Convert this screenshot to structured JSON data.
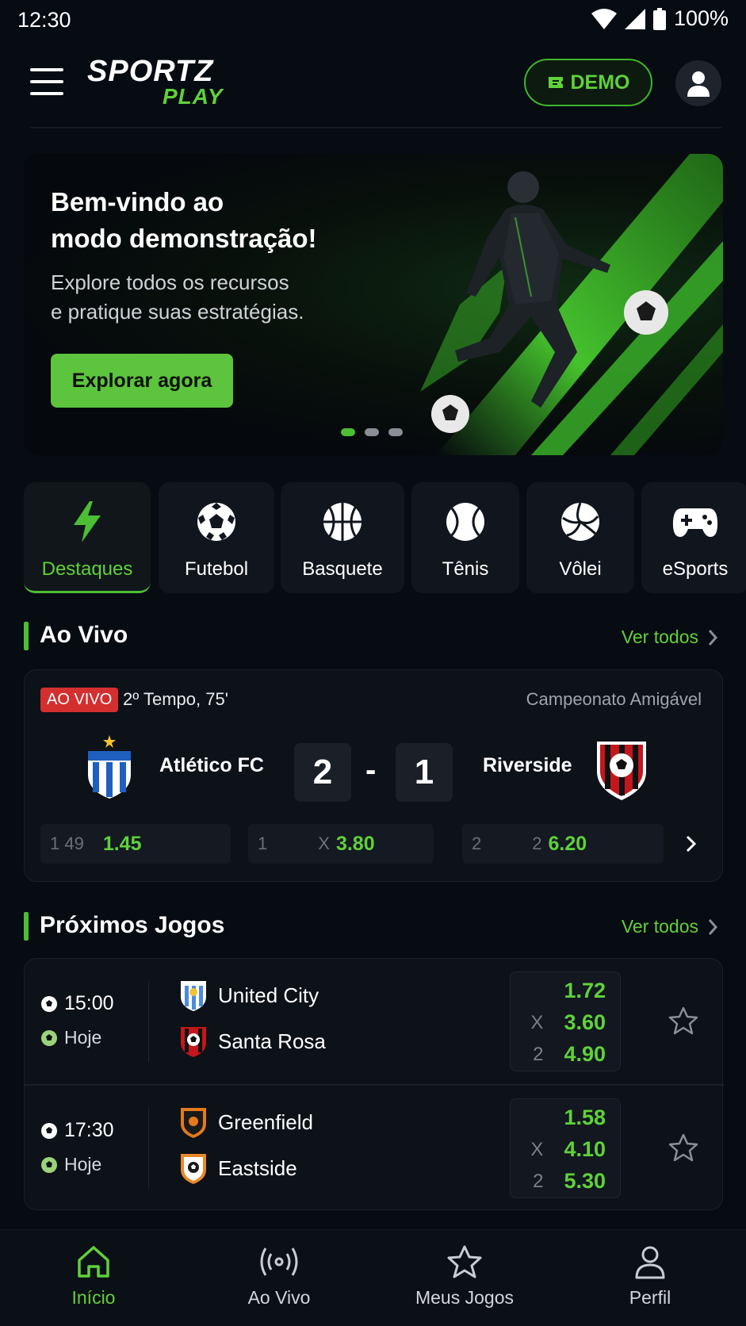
{
  "status_bar": {
    "time": "12:30",
    "battery": "100%"
  },
  "header": {
    "logo_top": "SPORTZ",
    "logo_bottom": "PLAY",
    "demo_label": "DEMO"
  },
  "banner": {
    "title_line1": "Bem-vindo ao",
    "title_line2": "modo demonstração!",
    "subtitle_line1": "Explore todos os recursos",
    "subtitle_line2": "e pratique suas estratégias.",
    "cta": "Explorar agora",
    "active_slide": 1,
    "total_slides": 3
  },
  "categories": [
    {
      "label": "Destaques",
      "icon": "lightning-icon",
      "active": true
    },
    {
      "label": "Futebol",
      "icon": "soccer-ball-icon",
      "active": false
    },
    {
      "label": "Basquete",
      "icon": "basketball-icon",
      "active": false
    },
    {
      "label": "Tênis",
      "icon": "tennis-ball-icon",
      "active": false
    },
    {
      "label": "Vôlei",
      "icon": "volleyball-icon",
      "active": false
    },
    {
      "label": "eSports",
      "icon": "gamepad-icon",
      "active": false
    }
  ],
  "live": {
    "section_title": "Ao Vivo",
    "see_all": "Ver todos",
    "badge": "AO VIVO",
    "period": "2º Tempo, 75'",
    "competition": "Campeonato Amigável",
    "home_team": "Atlético FC",
    "away_team": "Riverside",
    "home_score": "2",
    "separator": "-",
    "away_score": "1",
    "odds": [
      {
        "key": "1 49",
        "value": "1.45"
      },
      {
        "key": "1",
        "key2": "X",
        "value": "3.80"
      },
      {
        "key": "2",
        "key2": "2",
        "value": "6.20"
      }
    ]
  },
  "upcoming": {
    "section_title": "Próximos Jogos",
    "see_all": "Ver todos",
    "matches": [
      {
        "time": "15:00",
        "day": "Hoje",
        "home": "United City",
        "away": "Santa Rosa",
        "odds": [
          {
            "k": "",
            "v": "1.72"
          },
          {
            "k": "X",
            "v": "3.60"
          },
          {
            "k": "2",
            "v": "4.90"
          }
        ]
      },
      {
        "time": "17:30",
        "day": "Hoje",
        "home": "Greenfield",
        "away": "Eastside",
        "odds": [
          {
            "k": "",
            "v": "1.58"
          },
          {
            "k": "X",
            "v": "4.10"
          },
          {
            "k": "2",
            "v": "5.30"
          }
        ]
      }
    ]
  },
  "bottom_nav": [
    {
      "label": "Início",
      "icon": "home-icon",
      "active": true
    },
    {
      "label": "Ao Vivo",
      "icon": "broadcast-icon",
      "active": false
    },
    {
      "label": "Meus Jogos",
      "icon": "star-icon",
      "active": false
    },
    {
      "label": "Perfil",
      "icon": "user-icon",
      "active": false
    }
  ],
  "colors": {
    "accent": "#5fd13a",
    "background": "#070b12",
    "card": "#0d1118",
    "live_badge": "#d32f2f"
  }
}
